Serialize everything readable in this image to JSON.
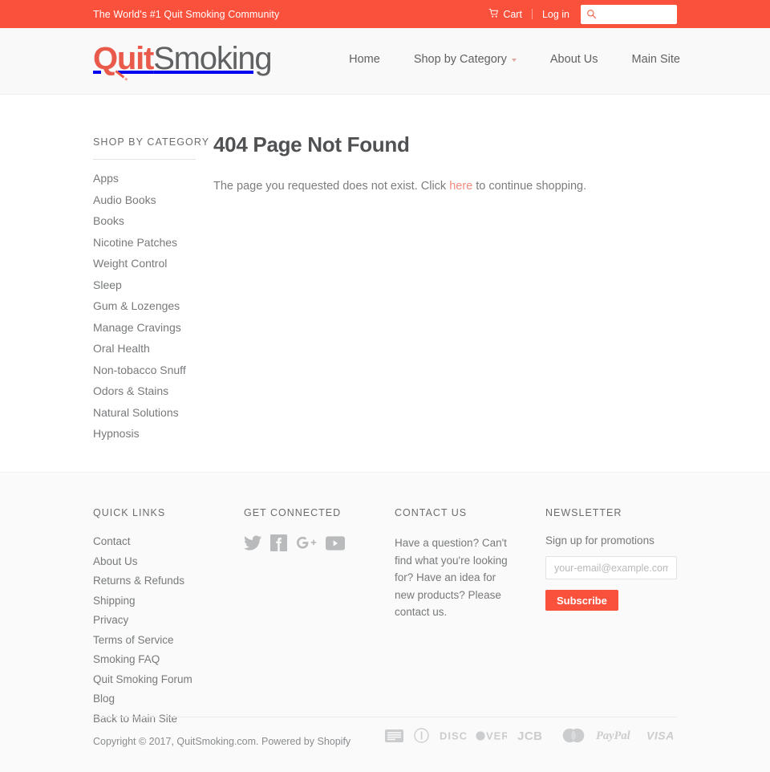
{
  "topbar": {
    "message": "The World's #1 Quit Smoking Community",
    "cart_label": "Cart",
    "cart_icon": "shopping-cart-icon",
    "login_label": "Log in",
    "search_icon": "search-icon",
    "search_value": "",
    "search_placeholder": "",
    "background_color": "#fa513c"
  },
  "header": {
    "logo_part1": "Quit",
    "logo_part2": "Smoking",
    "logo_color_1": "#ea5a4b",
    "logo_color_2": "#5f6163",
    "nav": [
      {
        "label": "Home",
        "has_chevron": false
      },
      {
        "label": "Shop by Category",
        "has_chevron": true
      },
      {
        "label": "About Us",
        "has_chevron": false
      },
      {
        "label": "Main Site",
        "has_chevron": false
      }
    ]
  },
  "sidebar": {
    "title": "SHOP BY CATEGORY",
    "items": [
      {
        "label": "Apps"
      },
      {
        "label": "Audio Books"
      },
      {
        "label": "Books"
      },
      {
        "label": "Nicotine Patches"
      },
      {
        "label": "Weight Control"
      },
      {
        "label": "Sleep"
      },
      {
        "label": "Gum & Lozenges"
      },
      {
        "label": "Manage Cravings"
      },
      {
        "label": "Oral Health"
      },
      {
        "label": "Non-tobacco Snuff"
      },
      {
        "label": "Odors & Stains"
      },
      {
        "label": "Natural Solutions"
      },
      {
        "label": "Hypnosis"
      }
    ]
  },
  "main": {
    "title": "404 Page Not Found",
    "body_before": "The page you requested does not exist. Click ",
    "body_link": "here",
    "body_after": " to continue shopping.",
    "link_color": "#f08b7d"
  },
  "footer": {
    "quick_links": {
      "heading": "QUICK LINKS",
      "items": [
        {
          "label": "Contact"
        },
        {
          "label": "About Us"
        },
        {
          "label": "Returns & Refunds"
        },
        {
          "label": "Shipping"
        },
        {
          "label": "Privacy"
        },
        {
          "label": "Terms of Service"
        },
        {
          "label": "Smoking FAQ"
        },
        {
          "label": "Quit Smoking Forum"
        },
        {
          "label": "Blog"
        },
        {
          "label": "Back to Main Site"
        }
      ]
    },
    "get_connected": {
      "heading": "GET CONNECTED",
      "social": [
        {
          "name": "twitter-icon"
        },
        {
          "name": "facebook-icon"
        },
        {
          "name": "google-plus-icon"
        },
        {
          "name": "youtube-icon"
        }
      ]
    },
    "contact": {
      "heading": "CONTACT US",
      "text": "Have a question? Can't find what you're looking for? Have an idea for new products? Please contact us."
    },
    "newsletter": {
      "heading": "NEWSLETTER",
      "subtitle": "Sign up for promotions",
      "email_value": "",
      "email_placeholder": "your-email@example.com",
      "button_label": "Subscribe",
      "button_color": "#fa513c"
    },
    "copyright": "Copyright © 2017, QuitSmoking.com. Powered by Shopify",
    "payments": [
      {
        "name": "amex-icon",
        "label": "AMEX"
      },
      {
        "name": "diners-club-icon",
        "label": "Diners Club"
      },
      {
        "name": "discover-icon",
        "label": "DISCOVER"
      },
      {
        "name": "jcb-icon",
        "label": "JCB"
      },
      {
        "name": "mastercard-icon",
        "label": "Mastercard"
      },
      {
        "name": "paypal-icon",
        "label": "PayPal"
      },
      {
        "name": "visa-icon",
        "label": "VISA"
      }
    ]
  }
}
